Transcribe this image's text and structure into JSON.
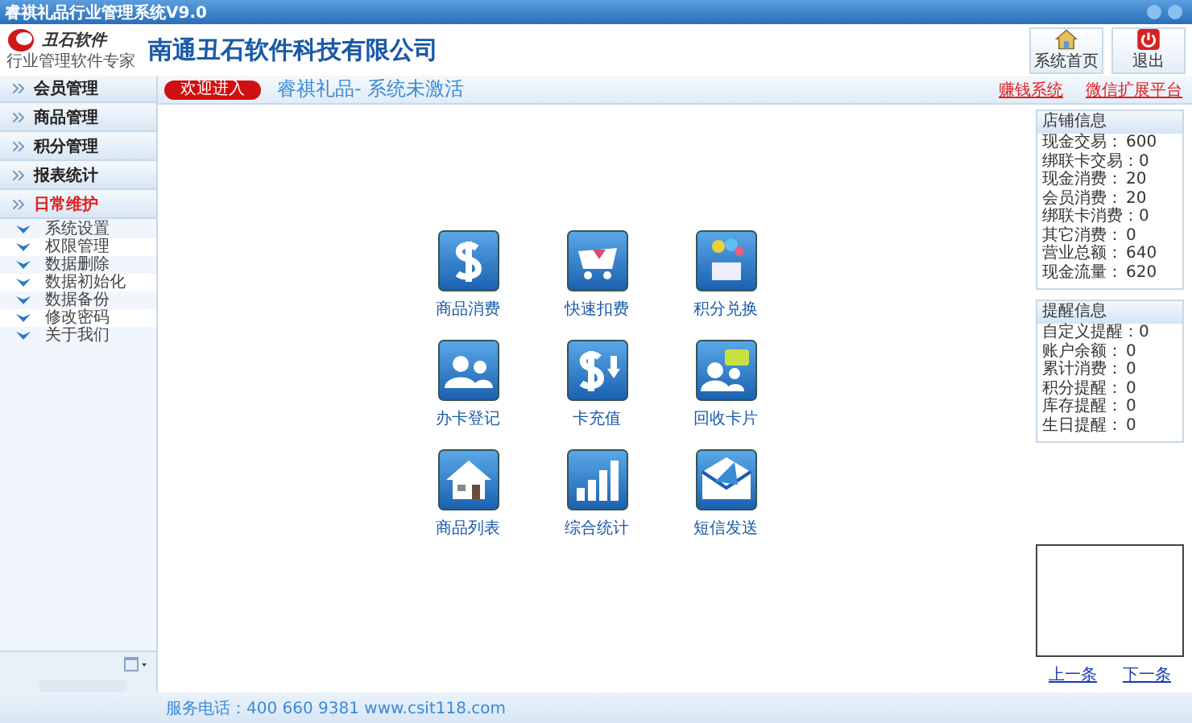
{
  "window": {
    "title": "睿祺礼品行业管理系统V9.0"
  },
  "logo": {
    "name": "丑石软件",
    "tagline": "行业管理软件专家"
  },
  "company": "南通丑石软件科技有限公司",
  "header_buttons": [
    {
      "label": "系统首页",
      "kind": "home"
    },
    {
      "label": "退出",
      "kind": "power"
    }
  ],
  "sidebar": {
    "groups": [
      {
        "label": "会员管理",
        "expanded": false
      },
      {
        "label": "商品管理",
        "expanded": false
      },
      {
        "label": "积分管理",
        "expanded": false
      },
      {
        "label": "报表统计",
        "expanded": false
      },
      {
        "label": "日常维护",
        "expanded": true,
        "children": [
          "系统设置",
          "权限管理",
          "数据删除",
          "数据初始化",
          "数据备份",
          "修改密码",
          "关于我们"
        ]
      }
    ]
  },
  "welcome": {
    "badge": "欢迎进入",
    "status": "睿祺礼品- 系统未激活"
  },
  "links": [
    "赚钱系统",
    "微信扩展平台"
  ],
  "tiles": [
    {
      "label": "商品消费",
      "kind": "dollar"
    },
    {
      "label": "快速扣费",
      "kind": "cart"
    },
    {
      "label": "积分兑换",
      "kind": "gift"
    },
    {
      "label": "办卡登记",
      "kind": "users"
    },
    {
      "label": "卡充值",
      "kind": "recharge"
    },
    {
      "label": "回收卡片",
      "kind": "chat"
    },
    {
      "label": "商品列表",
      "kind": "house"
    },
    {
      "label": "综合统计",
      "kind": "bars"
    },
    {
      "label": "短信发送",
      "kind": "mail"
    }
  ],
  "store_info": {
    "title": "店铺信息",
    "rows": [
      {
        "label": "现金交易：",
        "value": "600"
      },
      {
        "label": "绑联卡交易：",
        "value": "0"
      },
      {
        "label": "现金消费：",
        "value": "20"
      },
      {
        "label": "会员消费：",
        "value": "20"
      },
      {
        "label": "绑联卡消费：",
        "value": "0"
      },
      {
        "label": "其它消费：",
        "value": "0"
      },
      {
        "label": "营业总额：",
        "value": "640"
      },
      {
        "label": "现金流量：",
        "value": "620"
      }
    ]
  },
  "reminders": {
    "title": "提醒信息",
    "rows": [
      {
        "label": "自定义提醒：",
        "value": "0"
      },
      {
        "label": "账户余额：",
        "value": "0"
      },
      {
        "label": "累计消费：",
        "value": "0"
      },
      {
        "label": "积分提醒：",
        "value": "0"
      },
      {
        "label": "库存提醒：",
        "value": "0"
      },
      {
        "label": "生日提醒：",
        "value": "0"
      }
    ]
  },
  "pager": [
    "上一条",
    "下一条"
  ],
  "footer": "服务电话：400 660 9381 www.csit118.com"
}
